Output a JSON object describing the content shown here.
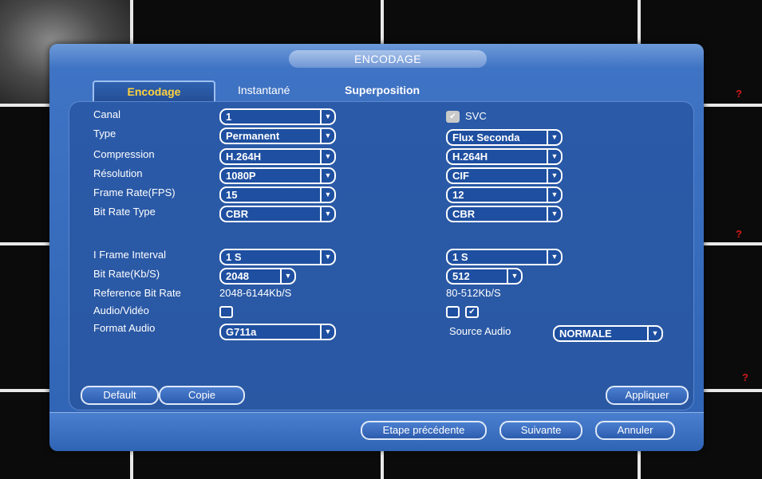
{
  "window": {
    "title": "ENCODAGE"
  },
  "tabs": [
    {
      "label": "Encodage",
      "active": true
    },
    {
      "label": "Instantané",
      "active": false
    },
    {
      "label": "Superposition",
      "active": false
    }
  ],
  "labels": {
    "canal": "Canal",
    "type": "Type",
    "compression": "Compression",
    "resolution": "Résolution",
    "frame_rate": "Frame Rate(FPS)",
    "bit_rate_type": "Bit Rate Type",
    "i_frame_interval": "I Frame Interval",
    "bit_rate": "Bit Rate(Kb/S)",
    "reference_bit_rate": "Reference Bit Rate",
    "audio_video": "Audio/Vidéo",
    "format_audio": "Format Audio",
    "svc": "SVC",
    "source_audio": "Source Audio"
  },
  "main_stream": {
    "canal": "1",
    "type": "Permanent",
    "compression": "H.264H",
    "resolution": "1080P",
    "frame_rate": "15",
    "bit_rate_type": "CBR",
    "i_frame_interval": "1 S",
    "bit_rate": "2048",
    "reference_bit_rate": "2048-6144Kb/S",
    "audio_video_checked": false,
    "format_audio": "G711a"
  },
  "sub_stream": {
    "svc_checked": true,
    "type": "Flux Seconda",
    "compression": "H.264H",
    "resolution": "CIF",
    "frame_rate": "12",
    "bit_rate_type": "CBR",
    "i_frame_interval": "1 S",
    "bit_rate": "512",
    "reference_bit_rate": "80-512Kb/S",
    "audio_checked": false,
    "video_checked": true,
    "source_audio": "NORMALE"
  },
  "buttons": {
    "default": "Default",
    "copie": "Copie",
    "appliquer": "Appliquer",
    "etape_precedente": "Etape précédente",
    "suivante": "Suivante",
    "annuler": "Annuler"
  },
  "icons": {
    "dropdown": "chevron-down-icon",
    "check": "check-icon",
    "warning": "question-mark-icon"
  },
  "colors": {
    "active_tab_text": "#ffd23d",
    "warning": "#d21a1a",
    "panel": "#2a5aa8"
  }
}
